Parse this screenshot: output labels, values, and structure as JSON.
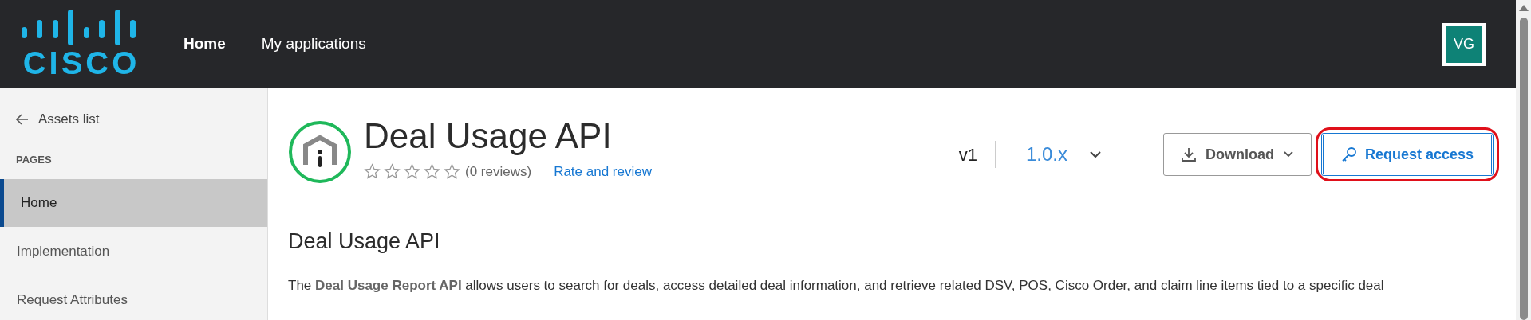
{
  "header": {
    "logo": "CISCO",
    "nav": [
      {
        "label": "Home",
        "selected": true
      },
      {
        "label": "My applications",
        "selected": false
      }
    ],
    "avatar": "VG"
  },
  "sidebar": {
    "back": "Assets list",
    "section": "PAGES",
    "items": [
      {
        "label": "Home",
        "selected": true
      },
      {
        "label": "Implementation",
        "selected": false
      },
      {
        "label": "Request Attributes",
        "selected": false
      }
    ]
  },
  "asset": {
    "title": "Deal Usage API",
    "stars": 0,
    "reviews": "(0 reviews)",
    "rate_link": "Rate and review",
    "version": "v1",
    "release": "1.0.x",
    "download": "Download",
    "request": "Request access"
  },
  "content": {
    "heading": "Deal Usage API",
    "paragraph": "The **Deal Usage Report API** allows users to search for deals, access detailed deal information, and retrieve related DSV, POS, Cisco Order, and claim line items tied to a specific deal"
  }
}
